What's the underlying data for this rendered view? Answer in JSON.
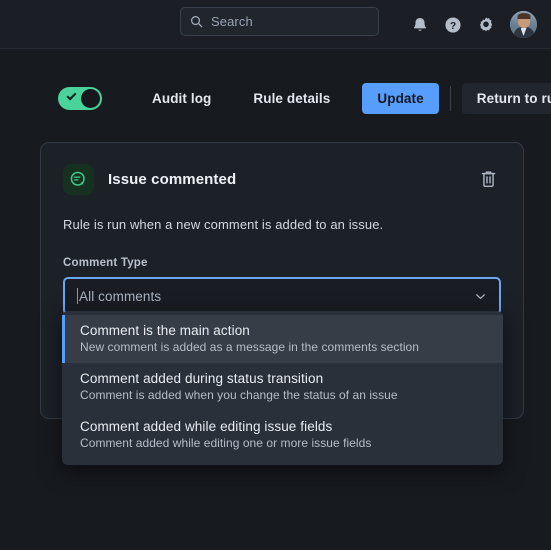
{
  "topbar": {
    "search": {
      "placeholder": "Search",
      "icon": "search-icon"
    },
    "icons": [
      {
        "name": "notification-bell-icon"
      },
      {
        "name": "help-circle-icon"
      },
      {
        "name": "settings-gear-icon"
      }
    ],
    "avatar_name": "user-avatar"
  },
  "actions": {
    "rule_enabled": true,
    "audit_log_label": "Audit log",
    "rule_details_label": "Rule details",
    "update_label": "Update",
    "return_label": "Return to rules"
  },
  "card": {
    "trigger_icon": "comment-bubble-icon",
    "title": "Issue commented",
    "description": "Rule is run when a new comment is added to an issue.",
    "delete_icon": "trash-icon",
    "field": {
      "label": "Comment Type",
      "value": "All comments",
      "placeholder": "All comments",
      "chevron_icon": "chevron-down-icon"
    }
  },
  "dropdown": {
    "options": [
      {
        "title": "Comment is the main action",
        "subtitle": "New comment is added as a message in the comments section",
        "selected": true
      },
      {
        "title": "Comment added during status transition",
        "subtitle": "Comment is added when you change the status of an issue",
        "selected": false
      },
      {
        "title": "Comment added while editing issue fields",
        "subtitle": "Comment added while editing one or more issue fields",
        "selected": false
      }
    ]
  },
  "colors": {
    "page_bg": "#171a1f",
    "card_bg": "#1c2027",
    "accent_blue": "#579dfb",
    "toggle_green": "#4ad39a",
    "dropdown_bg": "#2a303a",
    "dropdown_selected_bg": "#363d47"
  }
}
